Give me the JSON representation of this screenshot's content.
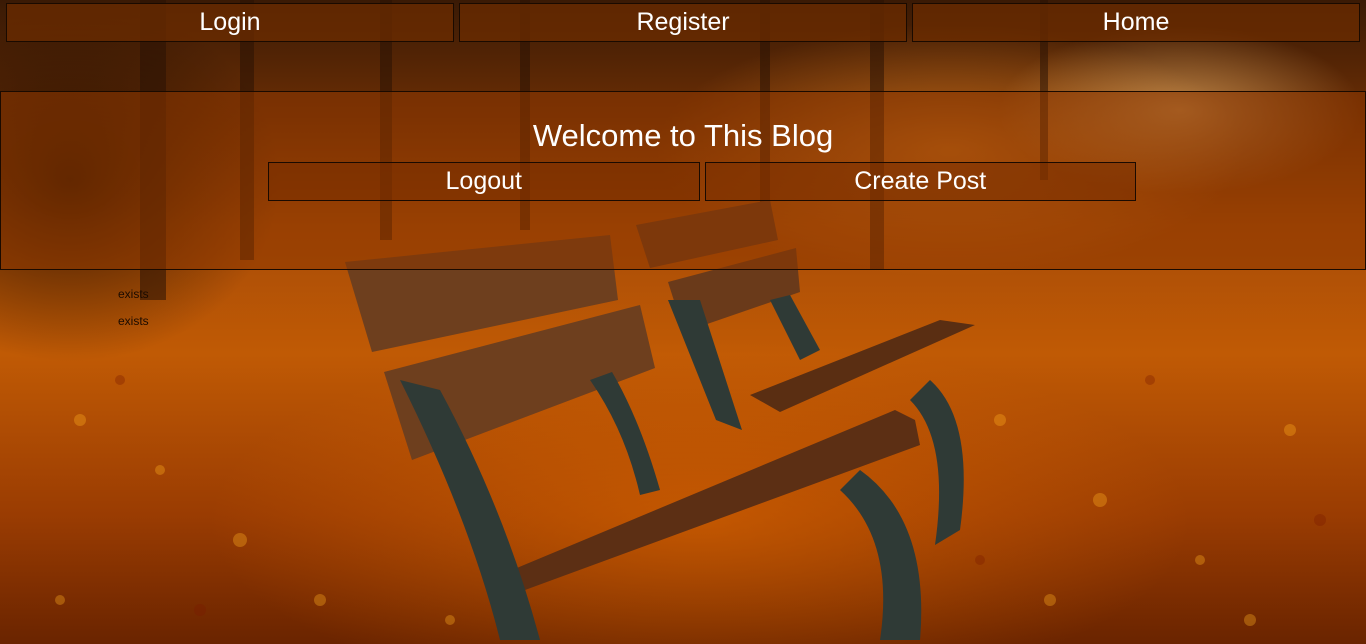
{
  "nav": {
    "login_label": "Login",
    "register_label": "Register",
    "home_label": "Home"
  },
  "welcome": {
    "title": "Welcome to This Blog",
    "logout_label": "Logout",
    "create_post_label": "Create Post"
  },
  "messages": [
    {
      "text": "exists"
    },
    {
      "text": "exists"
    }
  ],
  "background": {
    "image": "autumn-park-benches-photo",
    "accent_color": "#c05a05"
  }
}
